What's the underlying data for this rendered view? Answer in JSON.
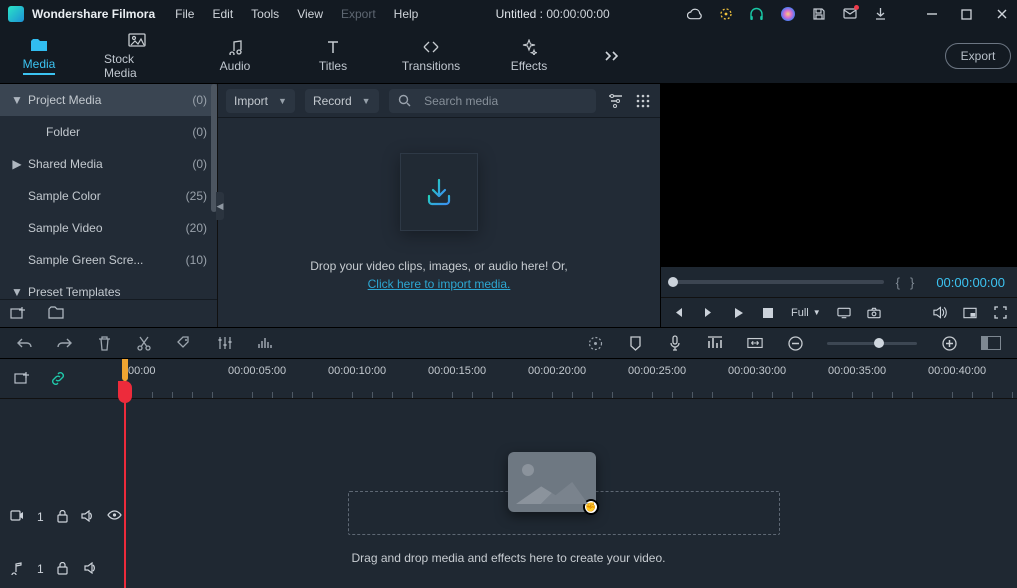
{
  "app_name": "Wondershare Filmora",
  "menubar": [
    "File",
    "Edit",
    "Tools",
    "View",
    "Export",
    "Help"
  ],
  "menubar_disabled_index": 4,
  "project": {
    "title_prefix": "Untitled : ",
    "timecode": "00:00:00:00"
  },
  "tabs": [
    {
      "label": "Media",
      "id": "media",
      "active": true
    },
    {
      "label": "Stock Media",
      "id": "stock-media"
    },
    {
      "label": "Audio",
      "id": "audio"
    },
    {
      "label": "Titles",
      "id": "titles"
    },
    {
      "label": "Transitions",
      "id": "transitions"
    },
    {
      "label": "Effects",
      "id": "effects"
    }
  ],
  "export_button": "Export",
  "sidebar": {
    "items": [
      {
        "label": "Project Media",
        "count": "(0)",
        "expand": "down",
        "selected": true
      },
      {
        "label": "Folder",
        "count": "(0)",
        "expand": "",
        "indent": true
      },
      {
        "label": "Shared Media",
        "count": "(0)",
        "expand": "right"
      },
      {
        "label": "Sample Color",
        "count": "(25)",
        "expand": ""
      },
      {
        "label": "Sample Video",
        "count": "(20)",
        "expand": ""
      },
      {
        "label": "Sample Green Scre...",
        "count": "(10)",
        "expand": ""
      },
      {
        "label": "Preset Templates",
        "count": "",
        "expand": "down"
      }
    ]
  },
  "media_toolbar": {
    "import_label": "Import",
    "record_label": "Record",
    "search_placeholder": "Search media"
  },
  "drop": {
    "line1": "Drop your video clips, images, or audio here! Or,",
    "link": "Click here to import media."
  },
  "preview": {
    "brace_l": "{",
    "brace_r": "}",
    "timecode": "00:00:00:00",
    "quality": "Full"
  },
  "ruler": {
    "ticks": [
      "00:00",
      "00:00:05:00",
      "00:00:10:00",
      "00:00:15:00",
      "00:00:20:00",
      "00:00:25:00",
      "00:00:30:00",
      "00:00:35:00",
      "00:00:40:00"
    ]
  },
  "tracks": {
    "video_label": "1",
    "audio_label": "1",
    "drop_message": "Drag and drop media and effects here to create your video."
  }
}
